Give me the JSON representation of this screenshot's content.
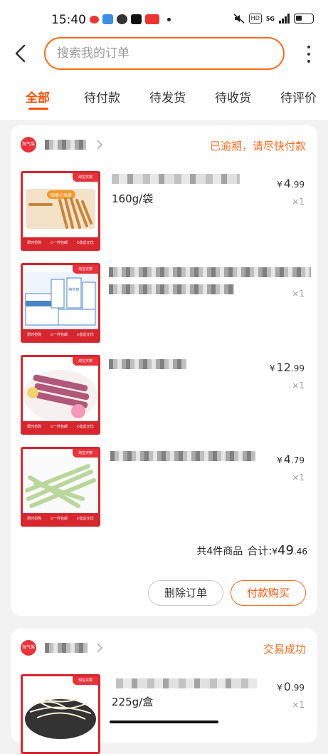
{
  "status_bar": {
    "time": "15:40",
    "hd": "HD",
    "net": "5G"
  },
  "search": {
    "placeholder": "搜索我的订单"
  },
  "tabs": [
    {
      "label": "全部",
      "active": true
    },
    {
      "label": "待付款",
      "active": false
    },
    {
      "label": "待发货",
      "active": false
    },
    {
      "label": "待收货",
      "active": false
    },
    {
      "label": "待评价",
      "active": false
    }
  ],
  "orders": [
    {
      "status": "已逾期，请尽快付款",
      "items": [
        {
          "spec": "160g/袋",
          "price_int": "4",
          "price_dec": ".99",
          "qty": "×1",
          "thumb_badge": "淘宝买菜",
          "thumb_strip": [
            "限时抢购",
            "⊙一件包邮",
            "⊙售后无忧"
          ],
          "thumb_text": "哈香小油条"
        },
        {
          "spec": "",
          "price_int": "",
          "price_dec": "",
          "qty": "×1",
          "thumb_badge": "淘宝买菜",
          "thumb_strip": [
            "限时抢购",
            "⊙一件包邮",
            "⊙售后无忧"
          ],
          "thumb_text": "纯牛奶"
        },
        {
          "spec": "",
          "price_int": "12",
          "price_dec": ".99",
          "qty": "×1",
          "thumb_badge": "淘宝买菜",
          "thumb_strip": [
            "限时抢购",
            "⊙一件包邮",
            "⊙售后无忧"
          ],
          "thumb_text": ""
        },
        {
          "spec": "",
          "price_int": "4",
          "price_dec": ".79",
          "qty": "×1",
          "thumb_badge": "淘宝买菜",
          "thumb_strip": [
            "限时抢购",
            "⊙一件包邮",
            "⊙售后无忧"
          ],
          "thumb_text": ""
        }
      ],
      "summary": {
        "count": "共4件商品",
        "label": "合计:",
        "currency": "¥",
        "total_int": "49",
        "total_dec": ".46"
      },
      "buttons": {
        "delete": "删除订单",
        "pay": "付款购买"
      }
    },
    {
      "status": "交易成功",
      "items": [
        {
          "spec": "225g/盒",
          "price_int": "0",
          "price_dec": ".99",
          "qty": "×1",
          "thumb_badge": "淘宝买菜"
        }
      ]
    }
  ],
  "currency": "¥",
  "shop_logo_text": "淘气菜",
  "colors": {
    "accent": "#ff5000",
    "accent_border": "#ff6a1a",
    "thumb_red": "#d8262f",
    "background": "#f2f2f2"
  }
}
